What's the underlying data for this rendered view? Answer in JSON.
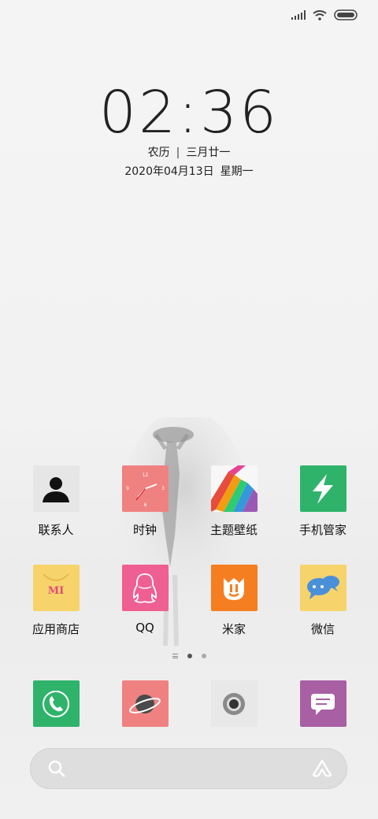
{
  "status_bar": {
    "signal": "signal-icon",
    "wifi": "wifi-icon",
    "battery": "battery-icon"
  },
  "clock": {
    "time": "02:36",
    "lunar_label": "农历",
    "lunar_date": "三月廿一",
    "date": "2020年04月13日",
    "weekday": "星期一"
  },
  "apps": [
    {
      "label": "联系人",
      "icon": "contacts-icon",
      "color": "#e6e6e6"
    },
    {
      "label": "时钟",
      "icon": "clock-icon",
      "color": "#f08181"
    },
    {
      "label": "主题壁纸",
      "icon": "themes-icon",
      "color": "#f7f7f7"
    },
    {
      "label": "手机管家",
      "icon": "security-icon",
      "color": "#2fb36b"
    },
    {
      "label": "应用商店",
      "icon": "app-store-icon",
      "color": "#f7d36c",
      "icon_text": "MI"
    },
    {
      "label": "QQ",
      "icon": "qq-icon",
      "color": "#ef5f92"
    },
    {
      "label": "米家",
      "icon": "mijia-icon",
      "color": "#f57e20"
    },
    {
      "label": "微信",
      "icon": "wechat-icon",
      "color": "#f7d36c"
    }
  ],
  "dock": [
    {
      "icon": "phone-icon",
      "color": "#2fb36b"
    },
    {
      "icon": "browser-icon",
      "color": "#f08181"
    },
    {
      "icon": "camera-icon",
      "color": "#e8e8e8"
    },
    {
      "icon": "messages-icon",
      "color": "#a85fa3"
    }
  ],
  "pages": {
    "count": 2,
    "active": 0
  },
  "search": {
    "icon": "search-icon",
    "assistant_icon": "assistant-icon"
  }
}
